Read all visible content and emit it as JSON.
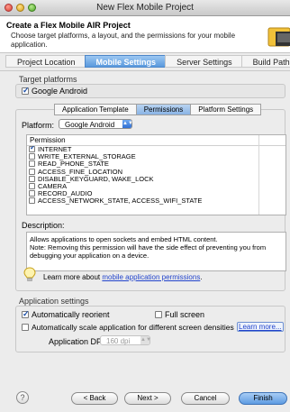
{
  "window": {
    "title": "New Flex Mobile Project"
  },
  "header": {
    "title": "Create a Flex Mobile AIR Project",
    "description": "Choose target platforms, a layout, and the permissions for your mobile application."
  },
  "steps": [
    {
      "label": "Project Location",
      "active": false
    },
    {
      "label": "Mobile Settings",
      "active": true
    },
    {
      "label": "Server Settings",
      "active": false
    },
    {
      "label": "Build Paths",
      "active": false
    }
  ],
  "target_platforms": {
    "group_label": "Target platforms",
    "google_android": {
      "label": "Google Android",
      "checked": true
    }
  },
  "tabs": [
    {
      "label": "Application Template",
      "selected": false
    },
    {
      "label": "Permissions",
      "selected": true
    },
    {
      "label": "Platform Settings",
      "selected": false
    }
  ],
  "platform": {
    "label": "Platform:",
    "selected": "Google Android"
  },
  "permissions": {
    "column_header": "Permission",
    "items": [
      {
        "label": "INTERNET",
        "checked": true
      },
      {
        "label": "WRITE_EXTERNAL_STORAGE",
        "checked": false
      },
      {
        "label": "READ_PHONE_STATE",
        "checked": false
      },
      {
        "label": "ACCESS_FINE_LOCATION",
        "checked": false
      },
      {
        "label": "DISABLE_KEYGUARD, WAKE_LOCK",
        "checked": false
      },
      {
        "label": "CAMERA",
        "checked": false
      },
      {
        "label": "RECORD_AUDIO",
        "checked": false
      },
      {
        "label": "ACCESS_NETWORK_STATE, ACCESS_WIFI_STATE",
        "checked": false
      }
    ]
  },
  "description": {
    "label": "Description:",
    "text": "Allows applications to open sockets and embed HTML content.\nNote: Removing this permission will have the side effect of preventing you from debugging your application on a device."
  },
  "learn_more": {
    "prefix": "Learn more about ",
    "link": "mobile application permissions",
    "suffix": "."
  },
  "app_settings": {
    "group_label": "Application settings",
    "auto_reorient": {
      "label": "Automatically reorient",
      "checked": true
    },
    "full_screen": {
      "label": "Full screen",
      "checked": false
    },
    "auto_scale": {
      "label": "Automatically scale application for different screen densities",
      "checked": false
    },
    "learn_more_btn": "Learn more...",
    "dpi_label": "Application DPI:",
    "dpi_value": "160 dpi"
  },
  "buttons": {
    "back": "< Back",
    "next": "Next >",
    "cancel": "Cancel",
    "finish": "Finish",
    "help": "?"
  },
  "colors": {
    "accent": "#5a99dd",
    "link": "#2244cc"
  }
}
